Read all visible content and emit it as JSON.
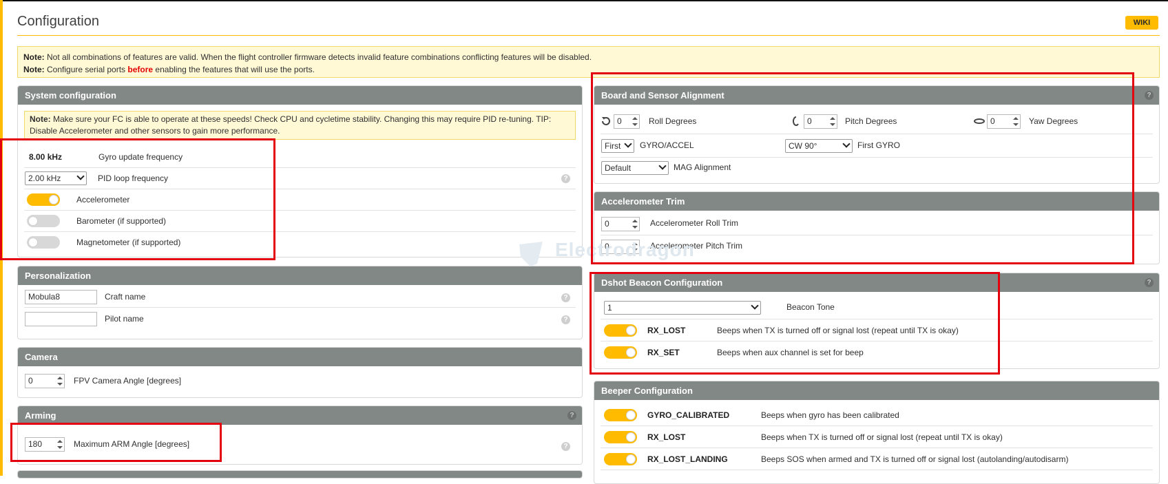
{
  "header": {
    "title": "Configuration",
    "wiki": "WIKI"
  },
  "notes": {
    "line1_prefix": "Note:",
    "line1_text": " Not all combinations of features are valid. When the flight controller firmware detects invalid feature combinations conflicting features will be disabled.",
    "line2_prefix": "Note:",
    "line2_text_a": " Configure serial ports ",
    "line2_emph": "before",
    "line2_text_b": " enabling the features that will use the ports."
  },
  "system": {
    "title": "System configuration",
    "note_prefix": "Note:",
    "note_text": " Make sure your FC is able to operate at these speeds! Check CPU and cycletime stability. Changing this may require PID re-tuning. TIP: Disable Accelerometer and other sensors to gain more performance.",
    "gyro_value": "8.00 kHz",
    "gyro_label": "Gyro update frequency",
    "pid_value": "2.00 kHz",
    "pid_label": "PID loop frequency",
    "accel_label": "Accelerometer",
    "accel_on": true,
    "baro_label": "Barometer (if supported)",
    "baro_on": false,
    "mag_label": "Magnetometer (if supported)",
    "mag_on": false
  },
  "personalization": {
    "title": "Personalization",
    "craft_value": "Mobula8",
    "craft_label": "Craft name",
    "pilot_value": "",
    "pilot_label": "Pilot name"
  },
  "camera": {
    "title": "Camera",
    "angle_value": "0",
    "angle_label": "FPV Camera Angle [degrees]"
  },
  "arming": {
    "title": "Arming",
    "arm_value": "180",
    "arm_label": "Maximum ARM Angle [degrees]"
  },
  "alignment": {
    "title": "Board and Sensor Alignment",
    "roll_value": "0",
    "roll_label": "Roll Degrees",
    "pitch_value": "0",
    "pitch_label": "Pitch Degrees",
    "yaw_value": "0",
    "yaw_label": "Yaw Degrees",
    "gyro_sel": "First",
    "gyro_sel_label": "GYRO/ACCEL",
    "cw_sel": "CW 90°",
    "cw_sel_label": "First GYRO",
    "mag_sel": "Default",
    "mag_sel_label": "MAG Alignment"
  },
  "acc_trim": {
    "title": "Accelerometer Trim",
    "roll_value": "0",
    "roll_label": "Accelerometer Roll Trim",
    "pitch_value": "0",
    "pitch_label": "Accelerometer Pitch Trim"
  },
  "dshot": {
    "title": "Dshot Beacon Configuration",
    "tone_value": "1",
    "tone_label": "Beacon Tone",
    "rows": [
      {
        "name": "RX_LOST",
        "desc": "Beeps when TX is turned off or signal lost (repeat until TX is okay)",
        "on": true
      },
      {
        "name": "RX_SET",
        "desc": "Beeps when aux channel is set for beep",
        "on": true
      }
    ]
  },
  "beeper": {
    "title": "Beeper Configuration",
    "rows": [
      {
        "name": "GYRO_CALIBRATED",
        "desc": "Beeps when gyro has been calibrated",
        "on": true
      },
      {
        "name": "RX_LOST",
        "desc": "Beeps when TX is turned off or signal lost (repeat until TX is okay)",
        "on": true
      },
      {
        "name": "RX_LOST_LANDING",
        "desc": "Beeps SOS when armed and TX is turned off or signal lost (autolanding/autodisarm)",
        "on": true
      }
    ]
  },
  "watermark": "Electrodragon",
  "colors": {
    "accent": "#ffbb00",
    "panel_header": "#828885",
    "highlight": "#e3000f"
  }
}
